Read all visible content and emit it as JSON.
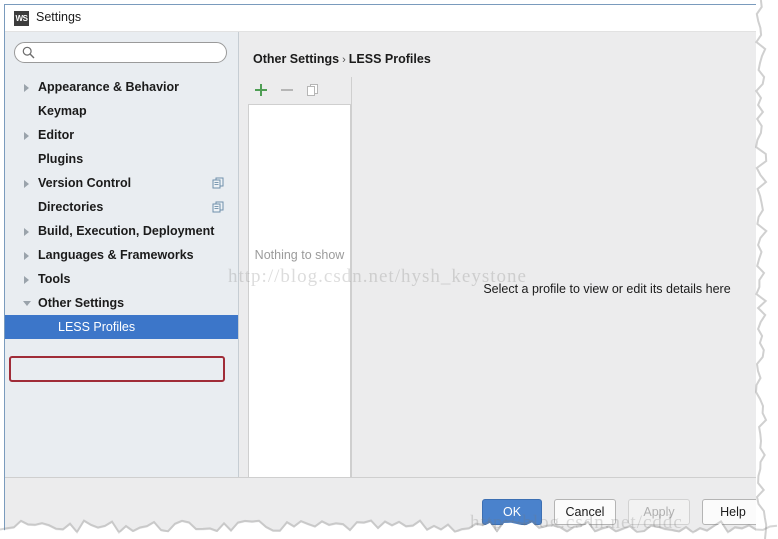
{
  "window": {
    "title": "Settings",
    "app_icon": "WS",
    "icon_name": "webstorm-icon"
  },
  "sidebar": {
    "search": {
      "value": "",
      "placeholder": "",
      "icon": "search-icon"
    },
    "items": [
      {
        "label": "Appearance & Behavior",
        "expandable": true,
        "expanded": false,
        "depth": 0,
        "selected": false,
        "badge": ""
      },
      {
        "label": "Keymap",
        "expandable": false,
        "expanded": false,
        "depth": 0,
        "selected": false,
        "badge": ""
      },
      {
        "label": "Editor",
        "expandable": true,
        "expanded": false,
        "depth": 0,
        "selected": false,
        "badge": ""
      },
      {
        "label": "Plugins",
        "expandable": false,
        "expanded": false,
        "depth": 0,
        "selected": false,
        "badge": ""
      },
      {
        "label": "Version Control",
        "expandable": true,
        "expanded": false,
        "depth": 0,
        "selected": false,
        "badge": "copy-icon"
      },
      {
        "label": "Directories",
        "expandable": false,
        "expanded": false,
        "depth": 0,
        "selected": false,
        "badge": "copy-icon"
      },
      {
        "label": "Build, Execution, Deployment",
        "expandable": true,
        "expanded": false,
        "depth": 0,
        "selected": false,
        "badge": ""
      },
      {
        "label": "Languages & Frameworks",
        "expandable": true,
        "expanded": false,
        "depth": 0,
        "selected": false,
        "badge": ""
      },
      {
        "label": "Tools",
        "expandable": true,
        "expanded": false,
        "depth": 0,
        "selected": false,
        "badge": ""
      },
      {
        "label": "Other Settings",
        "expandable": true,
        "expanded": true,
        "depth": 0,
        "selected": false,
        "badge": ""
      },
      {
        "label": "LESS Profiles",
        "expandable": false,
        "expanded": false,
        "depth": 1,
        "selected": true,
        "badge": ""
      }
    ],
    "selection_highlight_color": "#a02c38",
    "selection_row_color": "#3c76c9"
  },
  "pane": {
    "breadcrumb": {
      "parent": "Other Settings",
      "separator": "›",
      "current": "LESS Profiles"
    },
    "toolbar": [
      {
        "name": "add-button",
        "glyph": "plus-icon",
        "label": "+",
        "enabled": true,
        "color": "#4f9e54"
      },
      {
        "name": "remove-button",
        "glyph": "minus-icon",
        "label": "–",
        "enabled": false,
        "color": "#b6b6b6"
      },
      {
        "name": "copy-button",
        "glyph": "copy-icon",
        "label": "",
        "enabled": false,
        "color": "#b6b6b6"
      }
    ],
    "list_empty_text": "Nothing to show",
    "detail_hint": "Select a profile to view or edit its details here"
  },
  "footer": {
    "buttons": [
      {
        "name": "ok-button",
        "label": "OK",
        "style": "primary",
        "enabled": true
      },
      {
        "name": "cancel-button",
        "label": "Cancel",
        "style": "normal",
        "enabled": true
      },
      {
        "name": "apply-button",
        "label": "Apply",
        "style": "disabled",
        "enabled": false
      },
      {
        "name": "help-button",
        "label": "Help",
        "style": "normal",
        "enabled": true
      }
    ]
  },
  "watermarks": {
    "main": "http://blog.csdn.net/hysh_keystone",
    "bottom": "http://blog.csdn.net/cddc"
  }
}
